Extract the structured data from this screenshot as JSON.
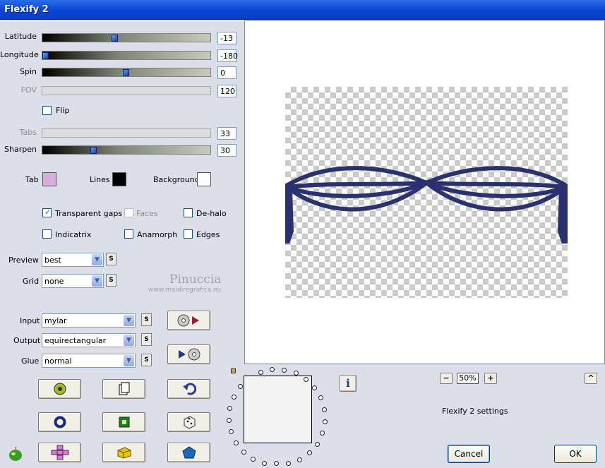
{
  "window": {
    "title": "Flexify 2"
  },
  "sliders": [
    {
      "label": "Latitude",
      "value": "-13",
      "level": 0.43,
      "enabled": true
    },
    {
      "label": "Longitude",
      "value": "-180",
      "level": 0.0,
      "enabled": true
    },
    {
      "label": "Spin",
      "value": "0",
      "level": 0.5,
      "enabled": true
    },
    {
      "label": "FOV",
      "value": "120",
      "enabled": false
    },
    {
      "label": "Tabs",
      "value": "33",
      "enabled": false
    },
    {
      "label": "Sharpen",
      "value": "30",
      "level": 0.3,
      "enabled": true
    }
  ],
  "flip": {
    "label": "Flip",
    "checked": false
  },
  "colors": {
    "tab": {
      "label": "Tab",
      "color": "#d9aede"
    },
    "lines": {
      "label": "Lines",
      "color": "#000000"
    },
    "background": {
      "label": "Background",
      "color": "#ffffff"
    }
  },
  "options": {
    "transparent_gaps": {
      "label": "Transparent gaps",
      "checked": true
    },
    "faces": {
      "label": "Faces",
      "checked": false
    },
    "de_halo": {
      "label": "De-halo",
      "checked": false
    },
    "indicatrix": {
      "label": "Indicatrix",
      "checked": false
    },
    "anamorph": {
      "label": "Anamorph",
      "checked": false
    },
    "edges": {
      "label": "Edges",
      "checked": false
    }
  },
  "preview_select": {
    "label": "Preview",
    "value": "best",
    "s": "S"
  },
  "grid_select": {
    "label": "Grid",
    "value": "none",
    "s": "S"
  },
  "watermark": {
    "name": "Pinuccia",
    "url": "www.maidiregrafica.eu"
  },
  "input_select": {
    "label": "Input",
    "value": "mylar",
    "s": "S"
  },
  "output_select": {
    "label": "Output",
    "value": "equirectangular",
    "s": "S"
  },
  "glue_select": {
    "label": "Glue",
    "value": "normal",
    "s": "S"
  },
  "zoom": {
    "minus": "−",
    "level": "50%",
    "plus": "+",
    "collapse": "^"
  },
  "settings_label": "Flexify 2 settings",
  "info_label": "i",
  "buttons": {
    "cancel": "Cancel",
    "ok": "OK"
  },
  "accent": "#0a46d4",
  "tab_color": "#d9aede",
  "pattern_color": "#2a316e"
}
